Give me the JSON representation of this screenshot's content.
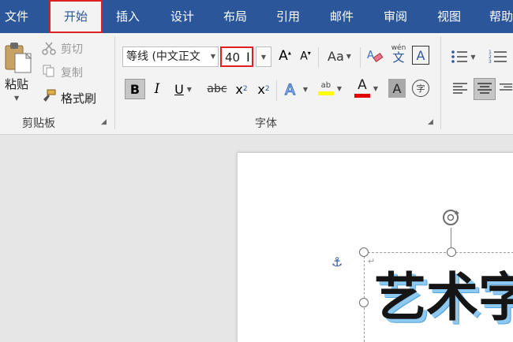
{
  "menu": {
    "file": "文件",
    "home": "开始",
    "insert": "插入",
    "design": "设计",
    "layout": "布局",
    "references": "引用",
    "mailings": "邮件",
    "review": "审阅",
    "view": "视图",
    "help": "帮助"
  },
  "clipboard": {
    "paste": "粘贴",
    "cut": "剪切",
    "copy": "复制",
    "format_painter": "格式刷",
    "label": "剪贴板"
  },
  "font": {
    "font_name": "等线 (中文正文",
    "font_size": "40",
    "change_case": "Aa",
    "phonetic": "wén",
    "phonetic_char": "文",
    "border_char": "A",
    "bold": "B",
    "italic": "I",
    "underline": "U",
    "strikethrough": "abc",
    "subscript": "x",
    "subscript_mark": "2",
    "superscript": "x",
    "superscript_mark": "2",
    "highlight_text": "ab",
    "font_color_text": "A",
    "shading_text": "A",
    "enclose_text": "字",
    "label": "字体"
  },
  "colors": {
    "accent": "#2b579a",
    "highlight": "#ffff00",
    "font_color": "#e00000",
    "selection_border": "#e02020"
  },
  "document": {
    "text": "艺术字"
  }
}
